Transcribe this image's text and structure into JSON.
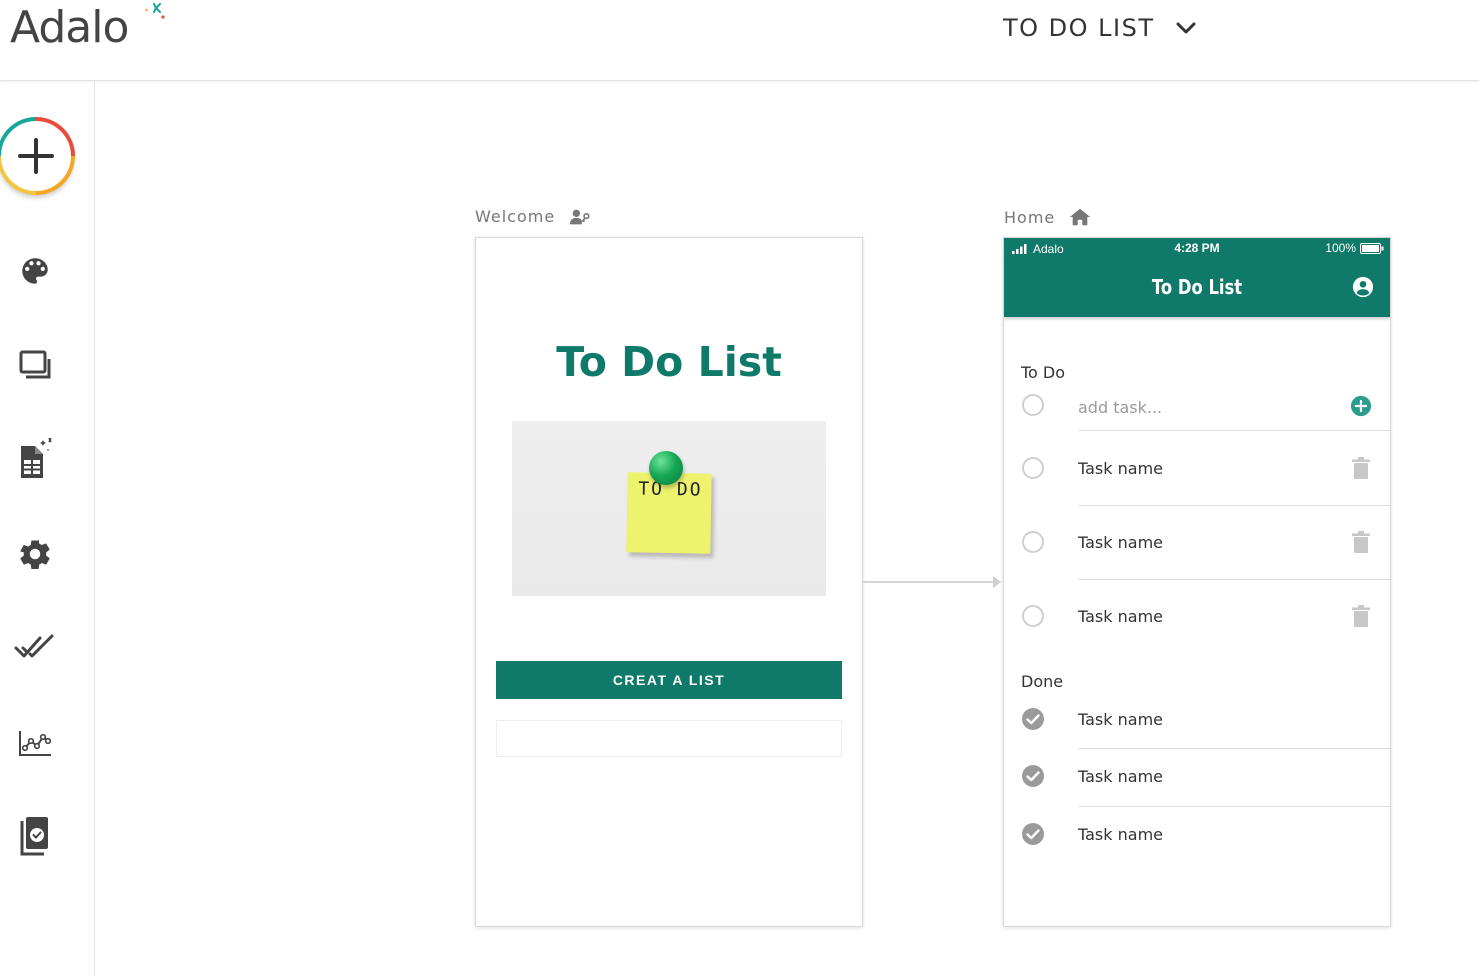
{
  "brand": {
    "logo_text": "Adalo",
    "logo_accent_colors": [
      "#f5a623",
      "#15a89a",
      "#e94b3c"
    ]
  },
  "header": {
    "app_name": "TO DO LIST"
  },
  "sidebar": {
    "items": [
      {
        "name": "add-component",
        "icon": "plus-icon"
      },
      {
        "name": "branding",
        "icon": "palette-icon"
      },
      {
        "name": "screens",
        "icon": "screens-icon"
      },
      {
        "name": "database",
        "icon": "database-icon"
      },
      {
        "name": "settings",
        "icon": "gear-icon"
      },
      {
        "name": "publish",
        "icon": "double-check-icon"
      },
      {
        "name": "analytics",
        "icon": "analytics-icon"
      },
      {
        "name": "version-history",
        "icon": "document-check-icon"
      }
    ]
  },
  "screens": {
    "welcome": {
      "label": "Welcome",
      "title": "To Do List",
      "image": {
        "sticky_text": "TO DO"
      },
      "button_label": "CREAT A LIST"
    },
    "home": {
      "label": "Home",
      "status": {
        "carrier": "Adalo",
        "time": "4:28 PM",
        "battery": "100%"
      },
      "title": "To Do List",
      "todo_heading": "To Do",
      "add_placeholder": "add task...",
      "todo_items": [
        {
          "name": "Task name"
        },
        {
          "name": "Task name"
        },
        {
          "name": "Task name"
        }
      ],
      "done_heading": "Done",
      "done_items": [
        {
          "name": "Task name"
        },
        {
          "name": "Task name"
        },
        {
          "name": "Task name"
        }
      ]
    }
  },
  "colors": {
    "primary": "#0f7a6a",
    "accent_add": "#2a9d8f"
  }
}
